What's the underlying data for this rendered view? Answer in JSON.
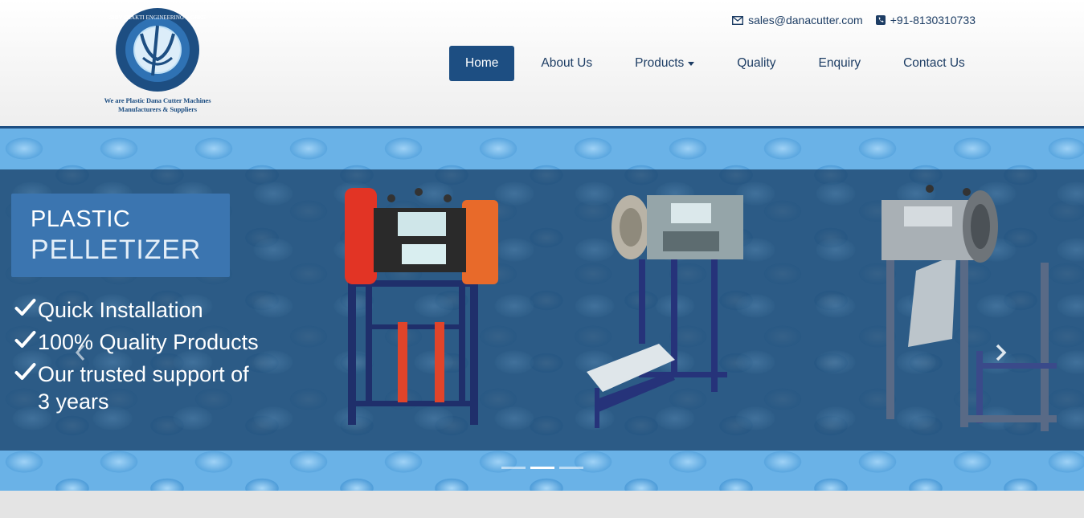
{
  "brand": {
    "logo_text_line1": "We are Plastic Dana Cutter Machines",
    "logo_text_line2": "Manufacturers & Suppliers",
    "seal_text": "SHIV SHAKTI ENGINEERING WORKS",
    "accent_color": "#1d4e82"
  },
  "contact": {
    "email": "sales@danacutter.com",
    "phone": "+91-8130310733",
    "email_icon": "envelope-icon",
    "phone_icon": "phone-icon"
  },
  "nav": {
    "items": [
      {
        "label": "Home",
        "active": true
      },
      {
        "label": "About Us"
      },
      {
        "label": "Products",
        "dropdown": true
      },
      {
        "label": "Quality"
      },
      {
        "label": "Enquiry"
      },
      {
        "label": "Contact Us"
      }
    ]
  },
  "hero": {
    "title_line1": "PLASTIC",
    "title_line2": "PELLETIZER",
    "features": [
      "Quick Installation",
      "100% Quality Products",
      "Our trusted support of 3 years"
    ],
    "slides_total": 3,
    "active_slide": 2
  }
}
